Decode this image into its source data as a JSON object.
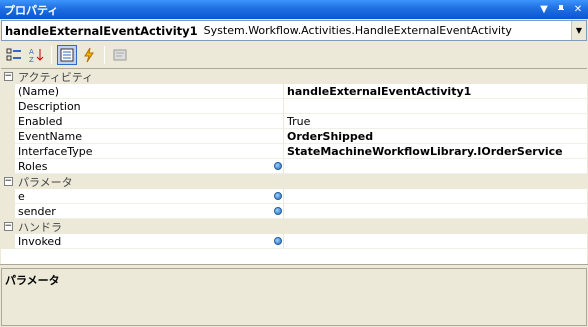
{
  "window": {
    "title": "プロパティ"
  },
  "selector": {
    "object_name": "handleExternalEventActivity1",
    "object_type": "System.Workflow.Activities.HandleExternalEventActivity"
  },
  "toolbar": {
    "buttons": [
      "categorized-icon",
      "alphabetical-icon",
      "properties-icon",
      "events-icon",
      "property-pages-icon"
    ]
  },
  "grid": {
    "categories": [
      {
        "name": "アクティビティ",
        "rows": [
          {
            "name": "(Name)",
            "value": "handleExternalEventActivity1",
            "bold": true
          },
          {
            "name": "Description",
            "value": ""
          },
          {
            "name": "Enabled",
            "value": "True"
          },
          {
            "name": "EventName",
            "value": "OrderShipped",
            "bold": true
          },
          {
            "name": "InterfaceType",
            "value": "StateMachineWorkflowLibrary.IOrderService",
            "bold": true
          },
          {
            "name": "Roles",
            "value": "",
            "bindable": true
          }
        ]
      },
      {
        "name": "パラメータ",
        "rows": [
          {
            "name": "e",
            "value": "",
            "bindable": true
          },
          {
            "name": "sender",
            "value": "",
            "bindable": true
          }
        ]
      },
      {
        "name": "ハンドラ",
        "rows": [
          {
            "name": "Invoked",
            "value": "",
            "bindable": true
          }
        ]
      }
    ]
  },
  "description": {
    "title": "パラメータ"
  },
  "colors": {
    "title_bar": "#0a55d6",
    "background": "#ece9d8",
    "grid": "#ffffff"
  }
}
